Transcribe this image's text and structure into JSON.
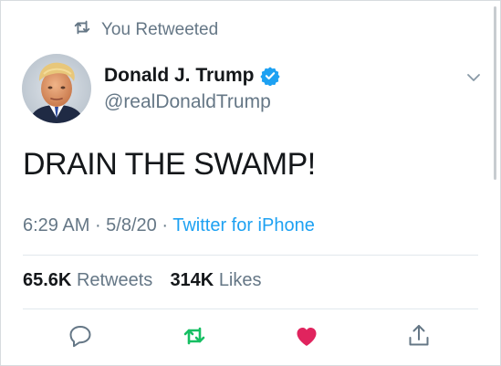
{
  "retweet_context": {
    "label": "You Retweeted",
    "icon": "retweet-icon"
  },
  "author": {
    "display_name": "Donald J. Trump",
    "handle": "@realDonaldTrump",
    "verified": true,
    "avatar": "profile-photo"
  },
  "tweet": {
    "text": "DRAIN THE SWAMP!",
    "time": "6:29 AM",
    "date": "5/8/20",
    "source": "Twitter for iPhone"
  },
  "stats": {
    "retweets_count": "65.6K",
    "retweets_label": "Retweets",
    "likes_count": "314K",
    "likes_label": "Likes"
  },
  "actions": [
    {
      "name": "reply",
      "icon": "reply-icon"
    },
    {
      "name": "retweet",
      "icon": "retweet-icon",
      "active": true
    },
    {
      "name": "like",
      "icon": "heart-icon",
      "active": true
    },
    {
      "name": "share",
      "icon": "share-icon"
    }
  ],
  "colors": {
    "brand_blue": "#1da1f2",
    "retweet_green": "#17bf63",
    "like_red": "#e0245e",
    "secondary_text": "#657786",
    "primary_text": "#14171a"
  }
}
